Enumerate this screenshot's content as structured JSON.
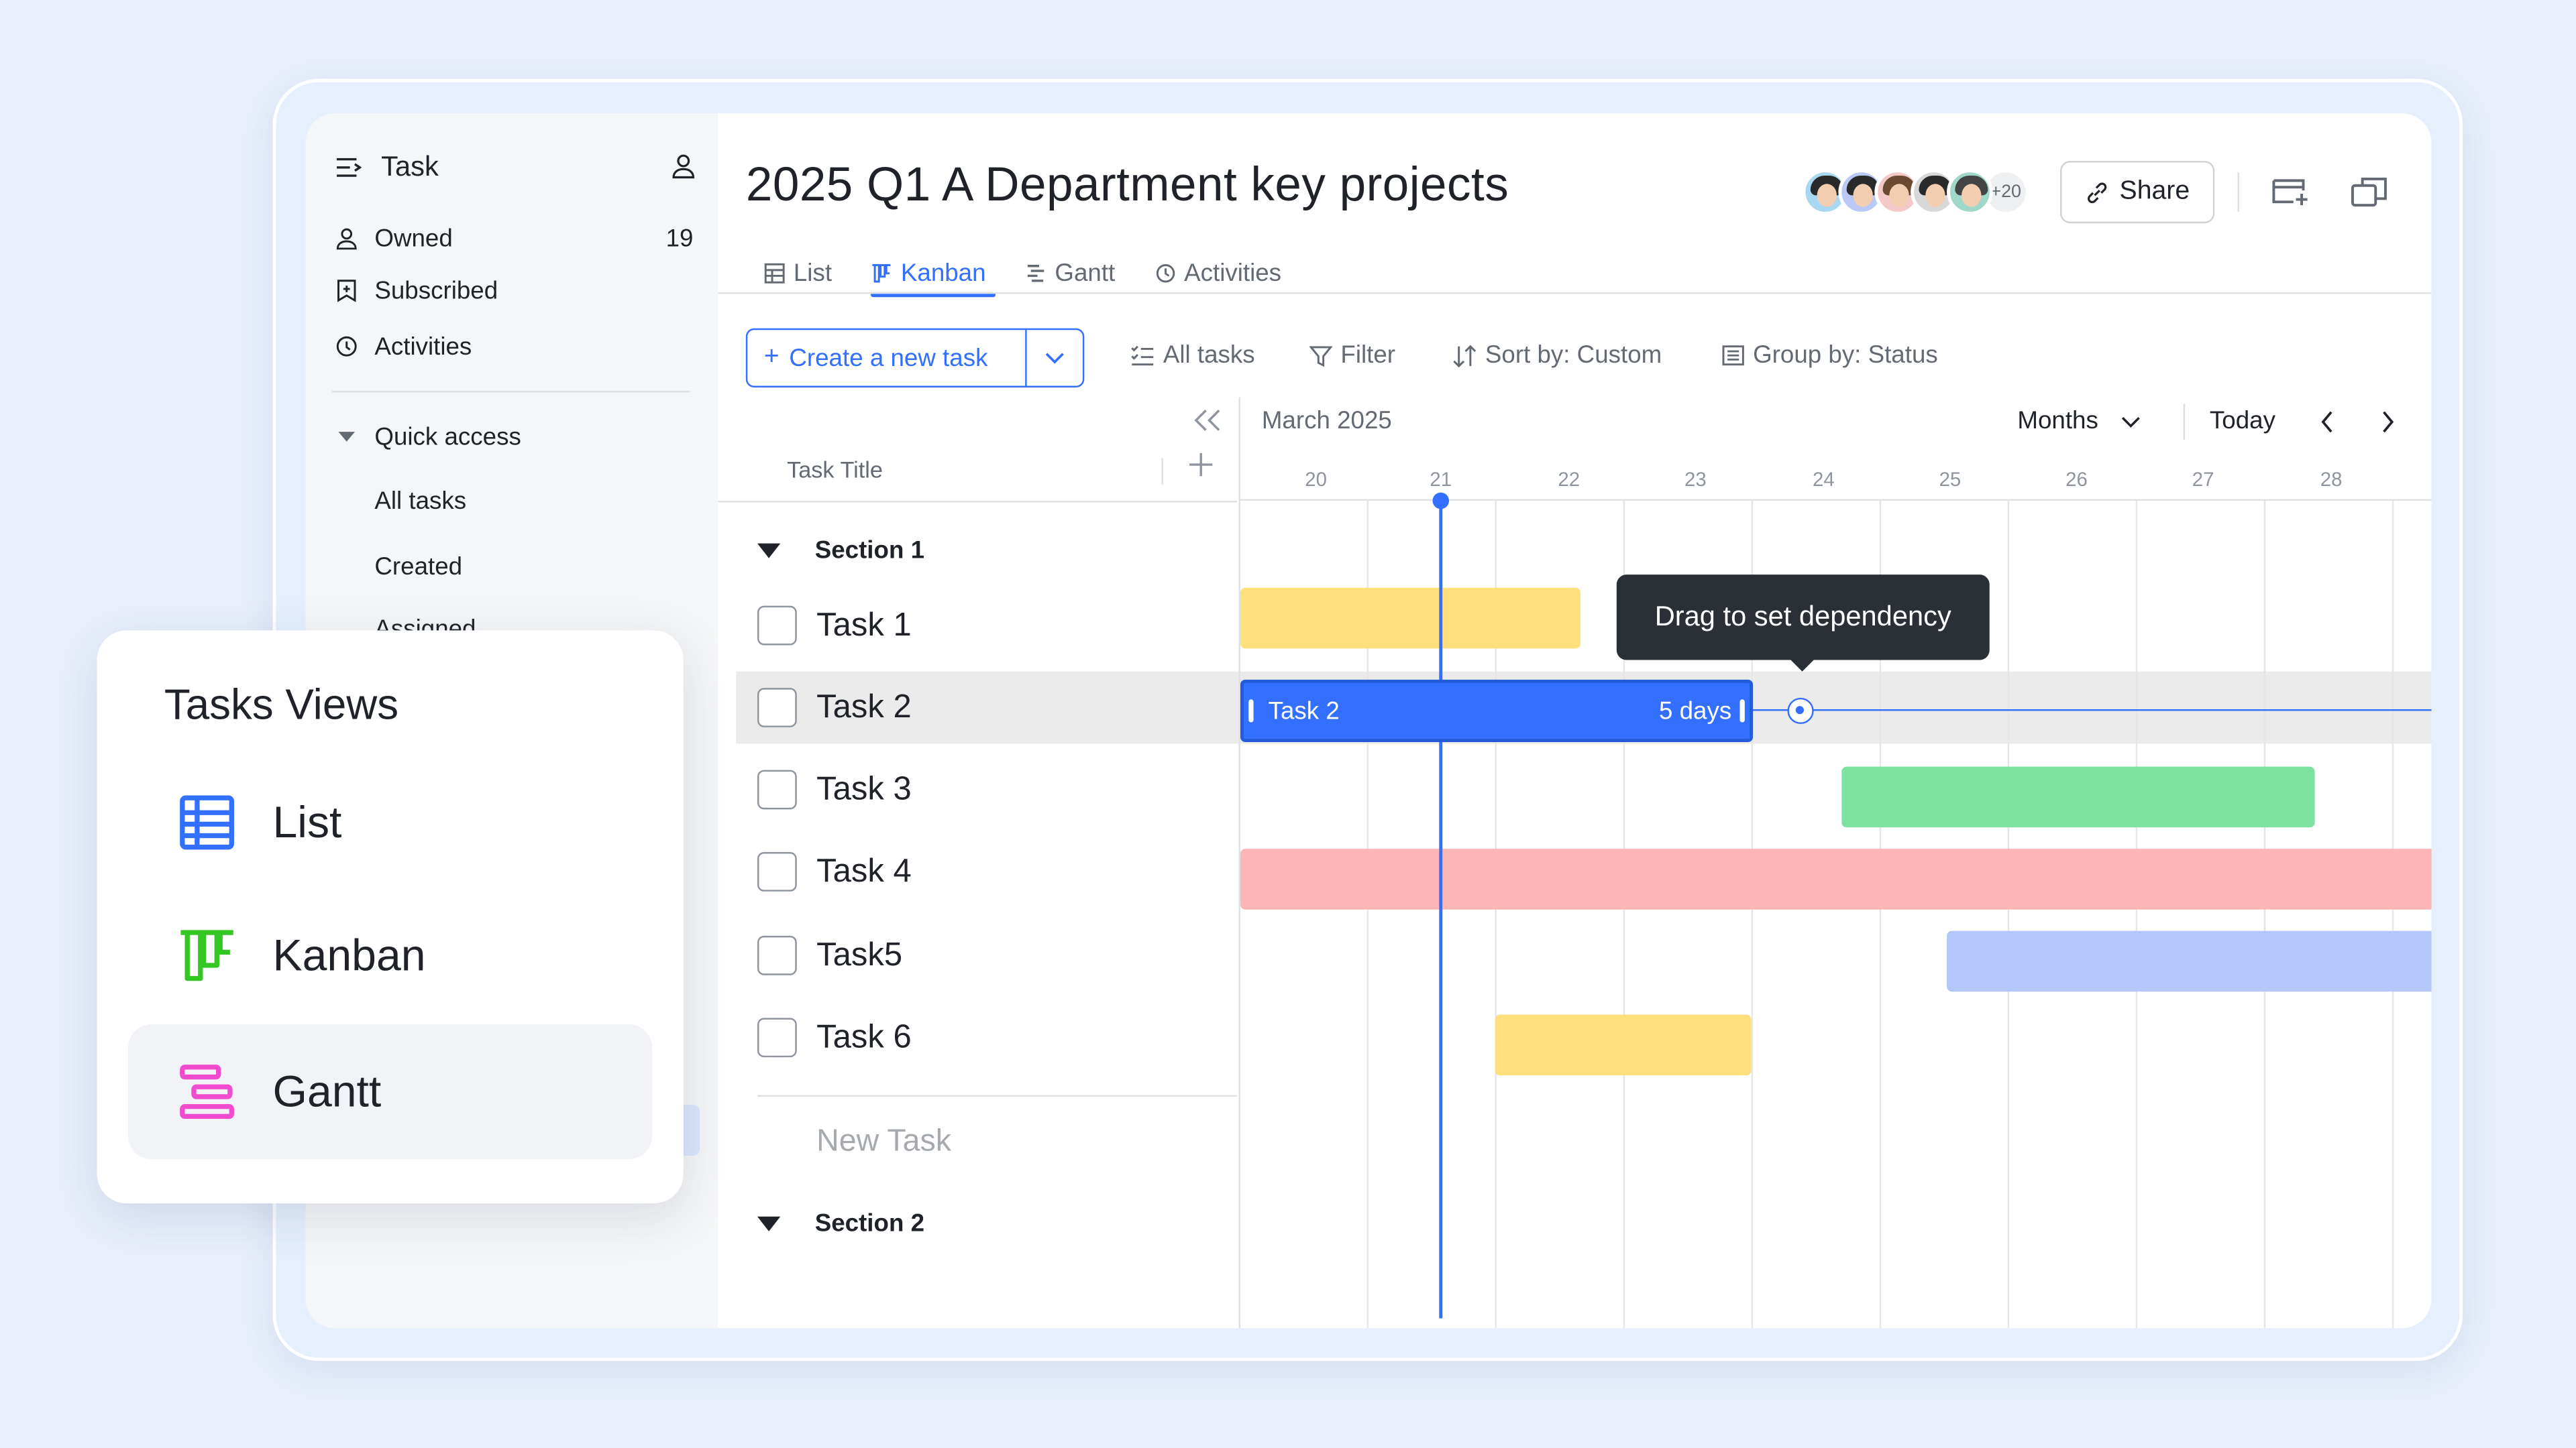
{
  "sidebar": {
    "title": "Task",
    "items": [
      {
        "label": "Owned",
        "count": "19",
        "icon": "user-icon"
      },
      {
        "label": "Subscribed",
        "icon": "bookmark-plus-icon"
      },
      {
        "label": "Activities",
        "icon": "history-icon"
      }
    ],
    "quick_access": {
      "label": "Quick access",
      "items": [
        {
          "label": "All tasks"
        },
        {
          "label": "Created"
        },
        {
          "label": "Assigned"
        }
      ]
    }
  },
  "header": {
    "title": "2025 Q1 A Department key projects",
    "members_more": "+20",
    "share_label": "Share"
  },
  "tabs": [
    {
      "label": "List",
      "icon": "table-icon"
    },
    {
      "label": "Kanban",
      "icon": "kanban-icon",
      "active": true
    },
    {
      "label": "Gantt",
      "icon": "gantt-icon"
    },
    {
      "label": "Activities",
      "icon": "history-icon"
    }
  ],
  "toolbar": {
    "create_label": "Create a new task",
    "all_tasks": "All tasks",
    "filter": "Filter",
    "sort": "Sort by: Custom",
    "group": "Group by: Status"
  },
  "table": {
    "column_title": "Task Title",
    "sections": [
      {
        "label": "Section 1",
        "tasks": [
          "Task 1",
          "Task 2",
          "Task 3",
          "Task 4",
          "Task5",
          "Task 6"
        ]
      },
      {
        "label": "Section 2",
        "tasks": []
      }
    ],
    "new_task_placeholder": "New Task"
  },
  "gantt": {
    "month": "March 2025",
    "scale": "Months",
    "today_label": "Today",
    "days": [
      "20",
      "21",
      "22",
      "23",
      "24",
      "25",
      "26",
      "27",
      "28"
    ],
    "selected_bar": {
      "label": "Task 2",
      "duration": "5 days"
    },
    "tooltip": "Drag to set dependency",
    "colors": {
      "yellow": "#ffe07d",
      "blue": "#3370ff",
      "green": "#7de2a2",
      "red": "#fbb6b5",
      "lavender": "#b4c7fb"
    }
  },
  "views_panel": {
    "title": "Tasks Views",
    "items": [
      {
        "label": "List",
        "icon": "list-view-icon",
        "color": "#3370ff"
      },
      {
        "label": "Kanban",
        "icon": "kanban-view-icon",
        "color": "#34c724"
      },
      {
        "label": "Gantt",
        "icon": "gantt-view-icon",
        "color": "#f14bd0",
        "selected": true
      }
    ]
  }
}
